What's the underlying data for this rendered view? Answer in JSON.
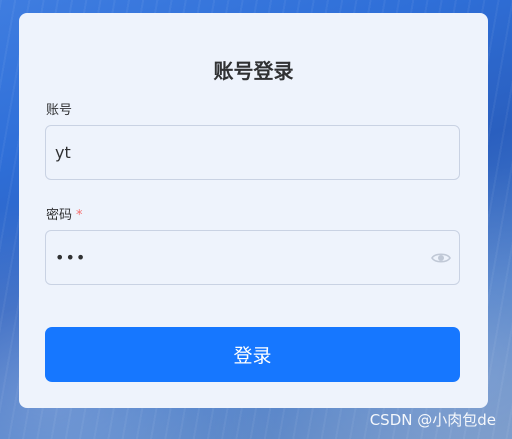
{
  "form": {
    "title": "账号登录",
    "account_label": "账号",
    "account_value": "yt",
    "password_label": "密码",
    "password_required_mark": "*",
    "password_display": "•••",
    "submit_label": "登录"
  },
  "watermark": {
    "text": "CSDN @小肉包de"
  },
  "icons": {
    "password_toggle": "eye-icon"
  },
  "colors": {
    "primary": "#1677ff",
    "required": "#f56c6c",
    "card_bg": "#eef3fc"
  }
}
